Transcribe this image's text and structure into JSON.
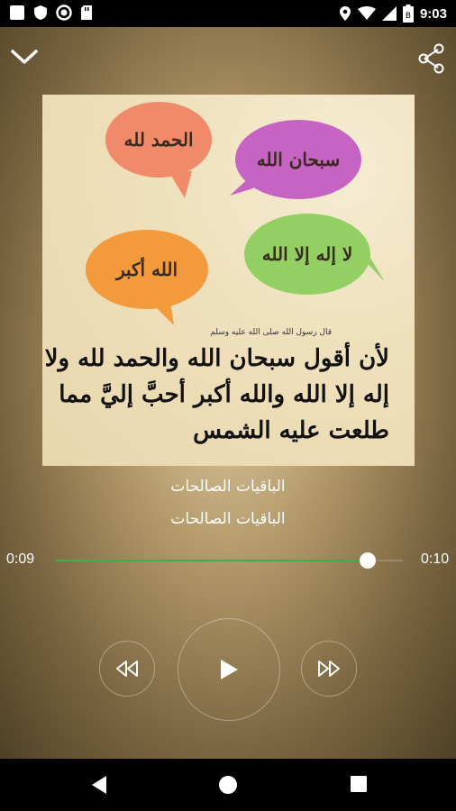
{
  "status_bar": {
    "time": "9:03",
    "left_icons": [
      "notification-icon",
      "shield-icon",
      "record-icon",
      "sd-card-icon"
    ],
    "right_icons": [
      "location-icon",
      "wifi-icon",
      "signal-icon",
      "battery-icon"
    ]
  },
  "toolbar": {
    "collapse_icon": "chevron-down-icon",
    "share_icon": "share-icon"
  },
  "artwork": {
    "bubbles": [
      "الحمد لله",
      "سبحان الله",
      "الله أكبر",
      "لا إله إلا الله"
    ],
    "attribution": "قال رسول الله صلى الله عليه وسلم",
    "lines": [
      "لأن أقول سبحان الله والحمد لله ولا",
      "إله إلا الله والله أكبر أحبَّ إليَّ مما",
      "طلعت عليه الشمس"
    ],
    "colors": {
      "bubble_salmon": "#f08a6a",
      "bubble_purple": "#c763c3",
      "bubble_orange": "#f39a3c",
      "bubble_green": "#93cf62"
    }
  },
  "track": {
    "title": "الباقيات الصالحات",
    "subtitle": "الباقيات الصالحات"
  },
  "progress": {
    "elapsed": "0:09",
    "total": "0:10",
    "fraction": 0.9,
    "accent_color": "#3fae4a"
  },
  "controls": {
    "rewind_icon": "rewind-icon",
    "play_icon": "play-icon",
    "forward_icon": "fast-forward-icon"
  },
  "nav_bar": {
    "back_icon": "back-icon",
    "home_icon": "home-icon",
    "recents_icon": "recents-icon"
  }
}
